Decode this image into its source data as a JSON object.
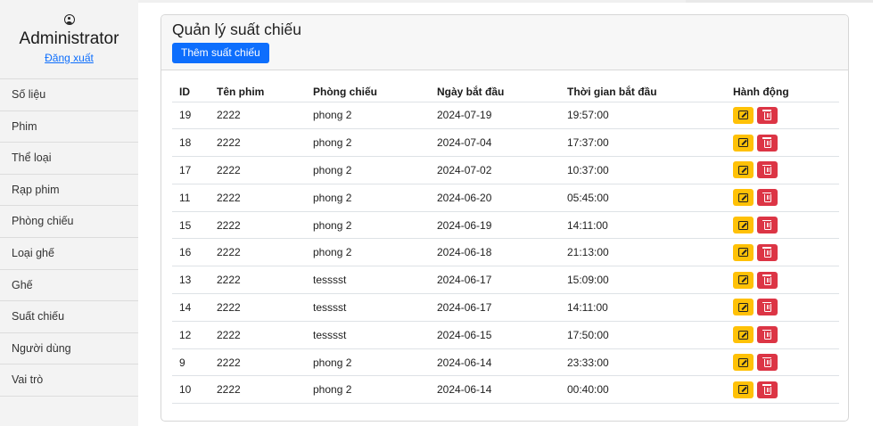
{
  "sidebar": {
    "user_icon": "user-circle-icon",
    "admin_name": "Administrator",
    "logout_label": "Đăng xuất",
    "items": [
      {
        "label": "Số liệu"
      },
      {
        "label": "Phim"
      },
      {
        "label": "Thể loại"
      },
      {
        "label": "Rạp phim"
      },
      {
        "label": "Phòng chiếu"
      },
      {
        "label": "Loại ghế"
      },
      {
        "label": "Ghế"
      },
      {
        "label": "Suất chiếu"
      },
      {
        "label": "Người dùng"
      },
      {
        "label": "Vai trò"
      }
    ]
  },
  "main": {
    "title": "Quản lý suất chiếu",
    "add_button_label": "Thêm suất chiếu",
    "table": {
      "headers": [
        "ID",
        "Tên phim",
        "Phòng chiếu",
        "Ngày bắt đầu",
        "Thời gian bắt đầu",
        "Hành động"
      ],
      "rows": [
        {
          "id": "19",
          "movie": "2222",
          "room": "phong 2",
          "date": "2024-07-19",
          "time": "19:57:00"
        },
        {
          "id": "18",
          "movie": "2222",
          "room": "phong 2",
          "date": "2024-07-04",
          "time": "17:37:00"
        },
        {
          "id": "17",
          "movie": "2222",
          "room": "phong 2",
          "date": "2024-07-02",
          "time": "10:37:00"
        },
        {
          "id": "11",
          "movie": "2222",
          "room": "phong 2",
          "date": "2024-06-20",
          "time": "05:45:00"
        },
        {
          "id": "15",
          "movie": "2222",
          "room": "phong 2",
          "date": "2024-06-19",
          "time": "14:11:00"
        },
        {
          "id": "16",
          "movie": "2222",
          "room": "phong 2",
          "date": "2024-06-18",
          "time": "21:13:00"
        },
        {
          "id": "13",
          "movie": "2222",
          "room": "tesssst",
          "date": "2024-06-17",
          "time": "15:09:00"
        },
        {
          "id": "14",
          "movie": "2222",
          "room": "tesssst",
          "date": "2024-06-17",
          "time": "14:11:00"
        },
        {
          "id": "12",
          "movie": "2222",
          "room": "tesssst",
          "date": "2024-06-15",
          "time": "17:50:00"
        },
        {
          "id": "9",
          "movie": "2222",
          "room": "phong 2",
          "date": "2024-06-14",
          "time": "23:33:00"
        },
        {
          "id": "10",
          "movie": "2222",
          "room": "phong 2",
          "date": "2024-06-14",
          "time": "00:40:00"
        }
      ],
      "row_actions": {
        "edit_icon": "edit-icon",
        "delete_icon": "trash-icon"
      }
    }
  },
  "colors": {
    "primary": "#0d6efd",
    "warning": "#ffc107",
    "danger": "#dc3545",
    "sidebar_bg": "#f3f3f3"
  }
}
